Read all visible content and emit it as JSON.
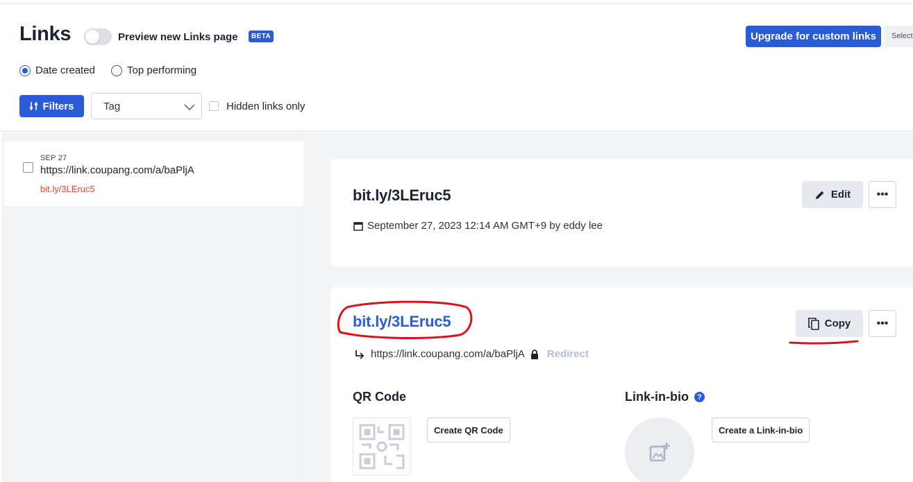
{
  "header": {
    "title": "Links",
    "preview_label": "Preview new Links page",
    "beta_badge": "BETA",
    "upgrade_button": "Upgrade for custom links",
    "select_button": "Select"
  },
  "sort": {
    "options": [
      {
        "label": "Date created",
        "selected": true
      },
      {
        "label": "Top performing",
        "selected": false
      }
    ]
  },
  "filters": {
    "filters_button": "Filters",
    "tag_select_value": "Tag",
    "hidden_links_label": "Hidden links only"
  },
  "link_list": [
    {
      "date": "SEP 27",
      "title": "https://link.coupang.com/a/baPljA",
      "short": "bit.ly/3LEruc5"
    }
  ],
  "detail": {
    "header_card": {
      "title": "bit.ly/3LEruc5",
      "edit_button": "Edit",
      "more_label": "•••",
      "created": "September 27, 2023 12:14 AM GMT+9 by eddy lee"
    },
    "link_card": {
      "short_link": "bit.ly/3LEruc5",
      "copy_button": "Copy",
      "more_label": "•••",
      "destination": "https://link.coupang.com/a/baPljA",
      "redirect_label": "Redirect",
      "qr_title": "QR Code",
      "qr_button": "Create QR Code",
      "bio_title": "Link-in-bio",
      "bio_help": "?",
      "bio_button": "Create a Link-in-bio"
    }
  },
  "colors": {
    "accent": "#2a5bd7",
    "short_link_red": "#e8472a",
    "annotation_red": "#e0101a"
  }
}
